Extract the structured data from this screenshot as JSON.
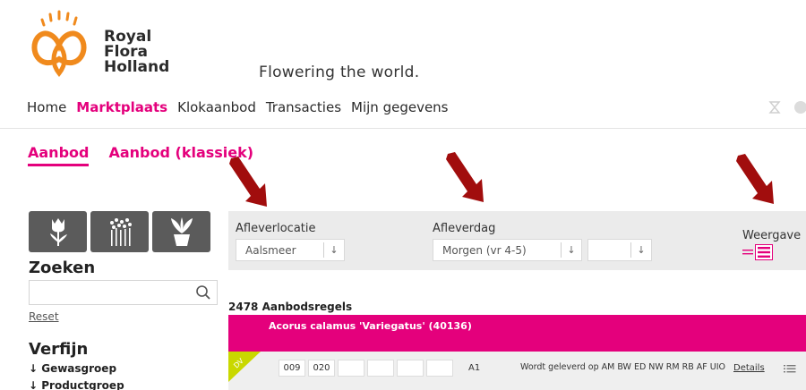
{
  "brand": {
    "line1": "Royal",
    "line2": "Flora",
    "line3": "Holland",
    "tagline": "Flowering the world."
  },
  "topnav": [
    {
      "label": "Home",
      "active": false
    },
    {
      "label": "Marktplaats",
      "active": true
    },
    {
      "label": "Klokaanbod",
      "active": false
    },
    {
      "label": "Transacties",
      "active": false
    },
    {
      "label": "Mijn gegevens",
      "active": false
    }
  ],
  "subtabs": [
    {
      "label": "Aanbod",
      "active": true
    },
    {
      "label": "Aanbod (klassiek)",
      "active": false
    }
  ],
  "sidebar": {
    "search_title": "Zoeken",
    "search_value": "",
    "reset_label": "Reset",
    "refine_title": "Verfijn",
    "refine_items": [
      "↓ Gewasgroep",
      "↓ Productgroep"
    ]
  },
  "filters": {
    "location_label": "Afleverlocatie",
    "location_value": "Aalsmeer",
    "day_label": "Afleverdag",
    "day_value": "Morgen (vr 4-5)",
    "day_extra_value": "",
    "view_label": "Weergave"
  },
  "results": {
    "count_text": "2478 Aanbodsregels",
    "product_name": "Acorus calamus 'Variegatus' (40136)",
    "row": {
      "badge": "DV",
      "cells": [
        "009",
        "020",
        "",
        "",
        "",
        ""
      ],
      "code": "A1",
      "delivery_text": "Wordt geleverd op  AM BW ED NW RM RB AF UIO",
      "details_label": "Details"
    }
  },
  "colors": {
    "accent": "#e4007c",
    "arrow": "#a10d0d",
    "logo_orange": "#f08a1d",
    "badge_green": "#c9d800"
  }
}
